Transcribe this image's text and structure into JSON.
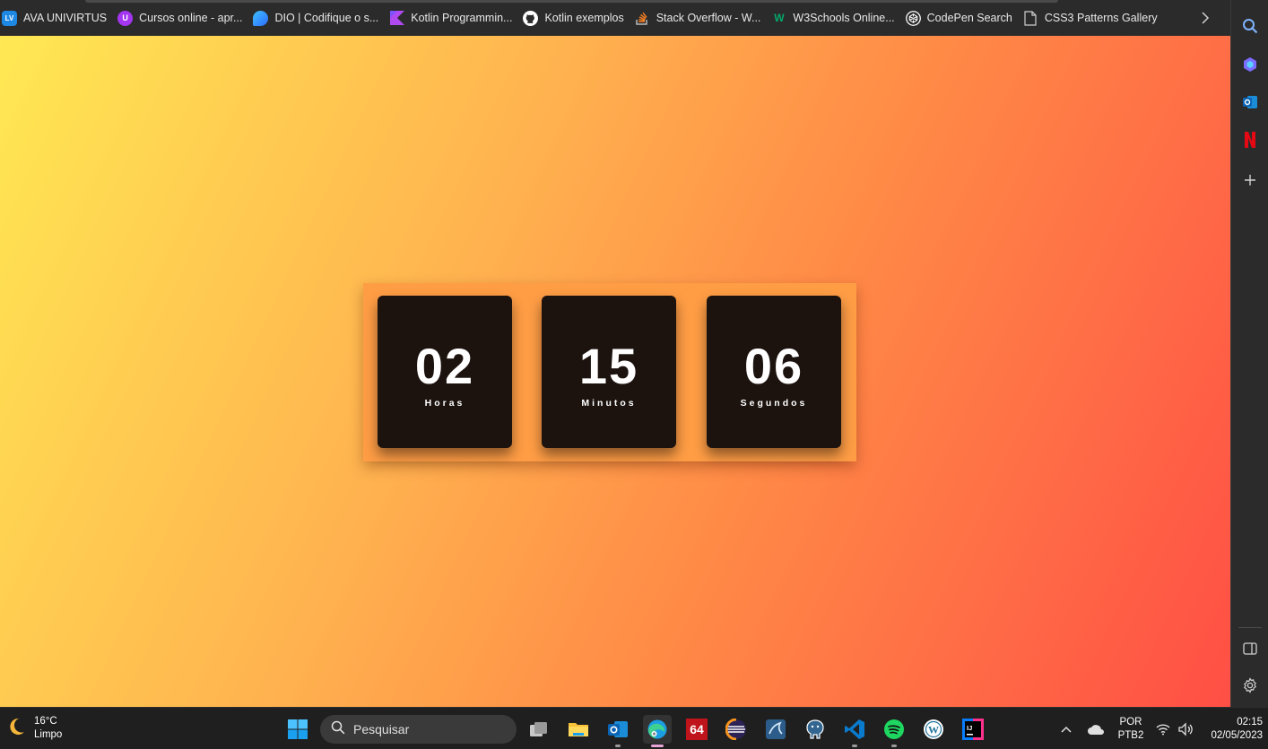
{
  "bookmarks": [
    {
      "label": "AVA UNIVIRTUS",
      "icon": "lv-logo-icon",
      "color": "#1e88e5",
      "glyph": "LV"
    },
    {
      "label": "Cursos online - apr...",
      "icon": "udemy-icon",
      "color": "#a435f0",
      "glyph": "U"
    },
    {
      "label": "DIO | Codifique o s...",
      "icon": "dio-drop-icon",
      "color": "#2d8cff",
      "glyph": ""
    },
    {
      "label": "Kotlin Programmin...",
      "icon": "kotlin-icon",
      "color": "#b04af0",
      "glyph": ""
    },
    {
      "label": "Kotlin exemplos",
      "icon": "github-icon",
      "color": "#ffffff",
      "glyph": ""
    },
    {
      "label": "Stack Overflow - W...",
      "icon": "stackoverflow-icon",
      "color": "#f48024",
      "glyph": ""
    },
    {
      "label": "W3Schools Online...",
      "icon": "w3schools-icon",
      "color": "#04aa6d",
      "glyph": "W"
    },
    {
      "label": "CodePen Search",
      "icon": "codepen-icon",
      "color": "#ffffff",
      "glyph": ""
    },
    {
      "label": "CSS3 Patterns Gallery",
      "icon": "page-icon",
      "color": "#cfcfcf",
      "glyph": ""
    }
  ],
  "clock": {
    "hours": {
      "value": "02",
      "label": "Horas"
    },
    "minutes": {
      "value": "15",
      "label": "Minutos"
    },
    "seconds": {
      "value": "06",
      "label": "Segundos"
    }
  },
  "sidebar": {
    "items": [
      "search-icon",
      "copilot-icon",
      "outlook-icon",
      "netflix-icon",
      "add-icon"
    ],
    "bottom": [
      "split-screen-icon",
      "settings-icon"
    ]
  },
  "taskbar": {
    "weather": {
      "temp": "16°C",
      "condition": "Limpo",
      "icon": "moon-icon"
    },
    "search_placeholder": "Pesquisar",
    "apps": [
      "windows-start-icon",
      "task-view-icon",
      "file-explorer-icon",
      "outlook-icon",
      "edge-icon",
      "dosbox-icon",
      "eclipse-icon",
      "mysql-workbench-icon",
      "postgresql-icon",
      "vscode-icon",
      "spotify-icon",
      "wordpress-icon",
      "intellij-icon"
    ],
    "language": {
      "line1": "POR",
      "line2": "PTB2"
    },
    "clock": {
      "time": "02:15",
      "date": "02/05/2023"
    }
  },
  "colors": {
    "accent_gradient_start": "#ffe853",
    "accent_gradient_end": "#ff4f45",
    "tile": "#1c130f",
    "panel": "#ff9d45"
  }
}
